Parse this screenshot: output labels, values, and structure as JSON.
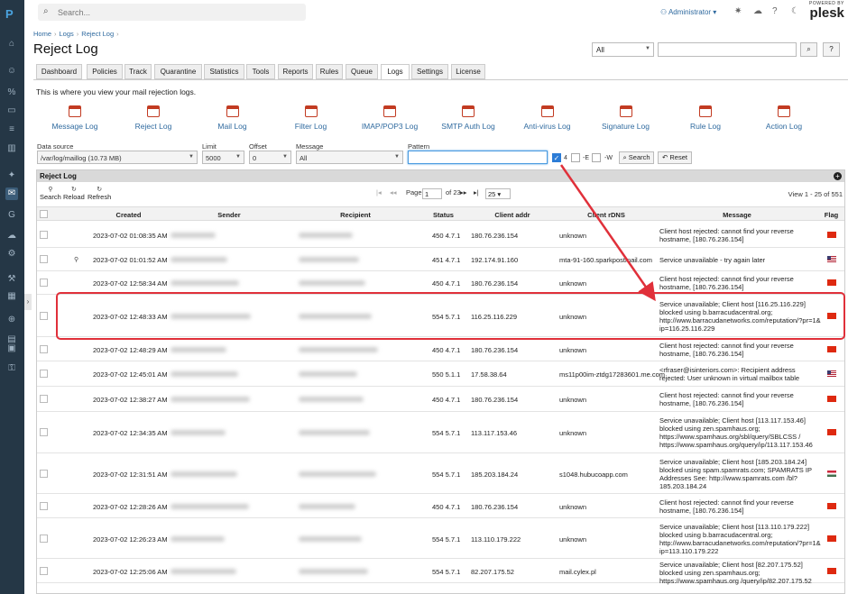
{
  "topbar": {
    "search_placeholder": "Search...",
    "user": "Administrator",
    "powered_by": "POWERED BY",
    "brand": "plesk"
  },
  "breadcrumb": [
    "Home",
    "Logs",
    "Reject Log"
  ],
  "page_title": "Reject Log",
  "filter": {
    "scope": "All"
  },
  "tabs": [
    "Dashboard",
    "Policies",
    "Track",
    "Quarantine",
    "Statistics",
    "Tools",
    "Reports",
    "Rules",
    "Queue",
    "Logs",
    "Settings",
    "License"
  ],
  "active_tab": "Logs",
  "intro": "This is where you view your mail rejection logs.",
  "log_types": [
    "Message Log",
    "Reject Log",
    "Mail Log",
    "Filter Log",
    "IMAP/POP3 Log",
    "SMTP Auth Log",
    "Anti-virus Log",
    "Signature Log",
    "Rule Log",
    "Action Log"
  ],
  "form": {
    "datasource_label": "Data source",
    "datasource_value": "/var/log/maillog (10.73 MB)",
    "limit_label": "Limit",
    "limit_value": "5000",
    "offset_label": "Offset",
    "offset_value": "0",
    "message_label": "Message",
    "message_value": "All",
    "pattern_label": "Pattern",
    "pattern_value": "",
    "opt_4": "4",
    "opt_e": "-E",
    "opt_w": "-W",
    "search_btn": "Search",
    "reset_btn": "Reset"
  },
  "grid": {
    "title": "Reject Log",
    "tools": [
      "Search",
      "Reload",
      "Refresh"
    ],
    "page_label": "Page",
    "page_value": "1",
    "page_of": "of 23",
    "page_size": "25",
    "view_count": "View 1 - 25 of 551",
    "columns": [
      "Created",
      "Sender",
      "Recipient",
      "Status",
      "Client addr",
      "Client rDNS",
      "Message",
      "Flag"
    ],
    "rows": [
      {
        "created": "2023-07-02 01:08:35 AM",
        "status": "450 4.7.1",
        "addr": "180.76.236.154",
        "rdns": "unknown",
        "message": "Client host rejected: cannot find your reverse hostname, [180.76.236.154]",
        "flag": "cn"
      },
      {
        "created": "2023-07-02 01:01:52 AM",
        "status": "451 4.7.1",
        "addr": "192.174.91.160",
        "rdns": "mta-91-160.sparkpostmail.com",
        "message": "Service unavailable - try again later",
        "flag": "us"
      },
      {
        "created": "2023-07-02 12:58:34 AM",
        "status": "450 4.7.1",
        "addr": "180.76.236.154",
        "rdns": "unknown",
        "message": "Client host rejected: cannot find your reverse hostname, [180.76.236.154]",
        "flag": "cn"
      },
      {
        "created": "2023-07-02 12:48:33 AM",
        "status": "554 5.7.1",
        "addr": "116.25.116.229",
        "rdns": "unknown",
        "message": "Service unavailable; Client host [116.25.116.229] blocked using b.barracudacentral.org; http://www.barracudanetworks.com/reputation/?pr=1& ip=116.25.116.229",
        "flag": "cn"
      },
      {
        "created": "2023-07-02 12:48:29 AM",
        "status": "450 4.7.1",
        "addr": "180.76.236.154",
        "rdns": "unknown",
        "message": "Client host rejected: cannot find your reverse hostname, [180.76.236.154]",
        "flag": "cn"
      },
      {
        "created": "2023-07-02 12:45:01 AM",
        "status": "550 5.1.1",
        "addr": "17.58.38.64",
        "rdns": "ms11p00im-ztdg17283601.me.com",
        "message": "<rfraser@isinteriors.com>: Recipient address rejected: User unknown in virtual mailbox table",
        "flag": "us"
      },
      {
        "created": "2023-07-02 12:38:27 AM",
        "status": "450 4.7.1",
        "addr": "180.76.236.154",
        "rdns": "unknown",
        "message": "Client host rejected: cannot find your reverse hostname, [180.76.236.154]",
        "flag": "cn"
      },
      {
        "created": "2023-07-02 12:34:35 AM",
        "status": "554 5.7.1",
        "addr": "113.117.153.46",
        "rdns": "unknown",
        "message": "Service unavailable; Client host [113.117.153.46] blocked using zen.spamhaus.org; https://www.spamhaus.org/sbl/query/SBLCSS / https://www.spamhaus.org/query/ip/113.117.153.46",
        "flag": "cn"
      },
      {
        "created": "2023-07-02 12:31:51 AM",
        "status": "554 5.7.1",
        "addr": "185.203.184.24",
        "rdns": "s1048.hubucoapp.com",
        "message": "Service unavailable; Client host [185.203.184.24] blocked using spam.spamrats.com; SPAMRATS IP Addresses See: http://www.spamrats.com /bl?185.203.184.24",
        "flag": "hu"
      },
      {
        "created": "2023-07-02 12:28:26 AM",
        "status": "450 4.7.1",
        "addr": "180.76.236.154",
        "rdns": "unknown",
        "message": "Client host rejected: cannot find your reverse hostname, [180.76.236.154]",
        "flag": "cn"
      },
      {
        "created": "2023-07-02 12:26:23 AM",
        "status": "554 5.7.1",
        "addr": "113.110.179.222",
        "rdns": "unknown",
        "message": "Service unavailable; Client host [113.110.179.222] blocked using b.barracudacentral.org; http://www.barracudanetworks.com/reputation/?pr=1& ip=113.110.179.222",
        "flag": "cn"
      },
      {
        "created": "2023-07-02 12:25:06 AM",
        "status": "554 5.7.1",
        "addr": "82.207.175.52",
        "rdns": "mail.cylex.pl",
        "message": "Service unavailable; Client host [82.207.175.52] blocked using zen.spamhaus.org; https://www.spamhaus.org /query/ip/82.207.175.52",
        "flag": "cn"
      }
    ]
  },
  "colors": {
    "accent": "#2f6a9f",
    "highlight": "#e0303a",
    "rail": "#253746"
  }
}
